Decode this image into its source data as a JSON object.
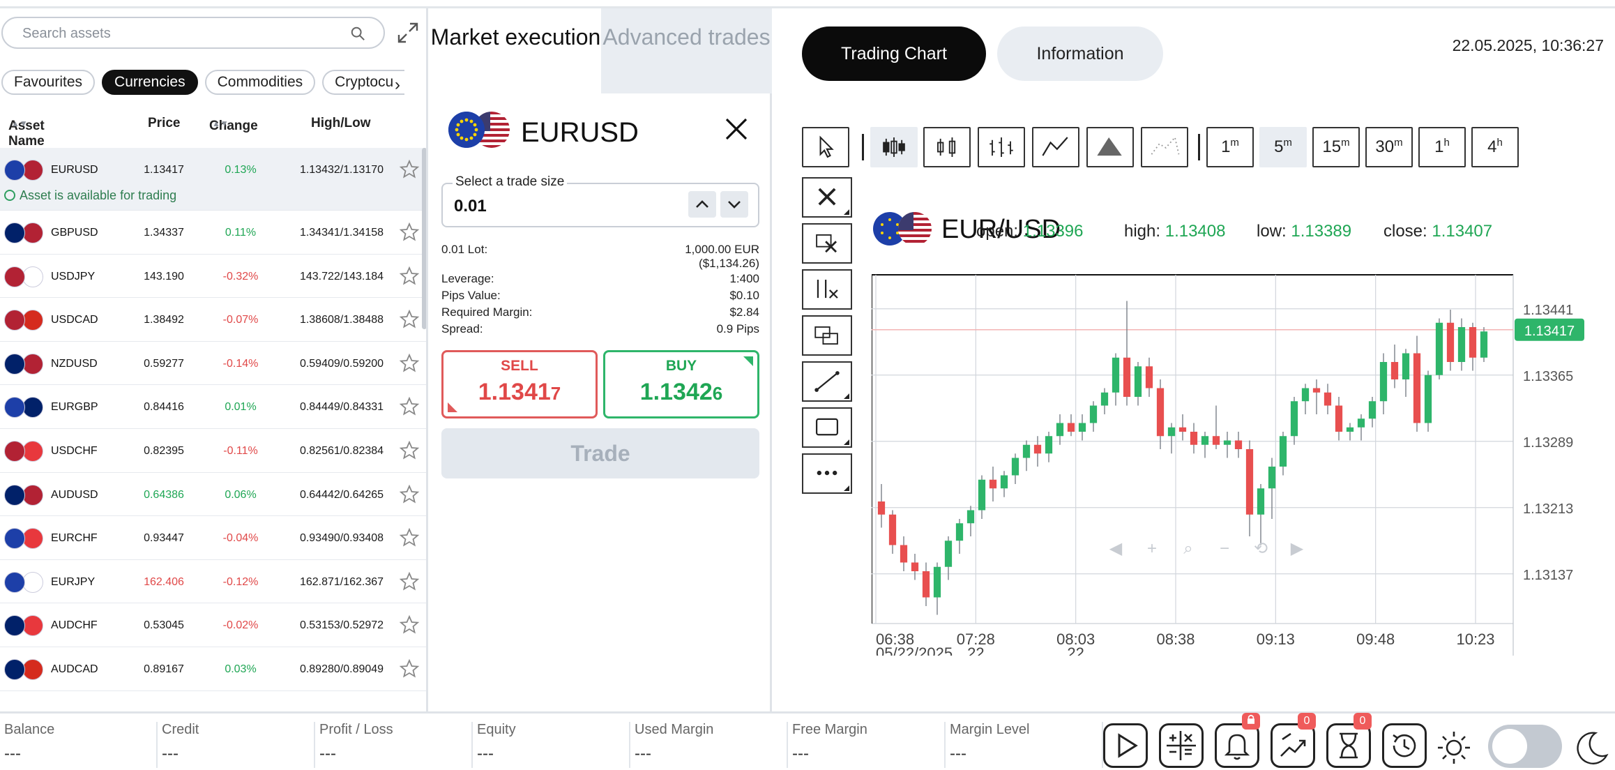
{
  "search": {
    "placeholder": "Search assets"
  },
  "filters": [
    "Favourites",
    "Currencies",
    "Commodities",
    "Cryptocu"
  ],
  "table": {
    "headers": {
      "name": "Asset Name",
      "price": "Price",
      "change": "Change",
      "highlow": "High/Low"
    },
    "available_text": "Asset is available for trading",
    "rows": [
      {
        "symbol": "EURUSD",
        "price": "1.13417",
        "change": "0.13%",
        "hl": "1.13432/1.13170",
        "dir": "pos",
        "pdir": "",
        "f1": "#1d3fa8",
        "f2": "#b22234"
      },
      {
        "symbol": "GBPUSD",
        "price": "1.34337",
        "change": "0.11%",
        "hl": "1.34341/1.34158",
        "dir": "pos",
        "pdir": "",
        "f1": "#012169",
        "f2": "#b22234"
      },
      {
        "symbol": "USDJPY",
        "price": "143.190",
        "change": "-0.32%",
        "hl": "143.722/143.184",
        "dir": "neg",
        "pdir": "",
        "f1": "#b22234",
        "f2": "#ffffff"
      },
      {
        "symbol": "USDCAD",
        "price": "1.38492",
        "change": "-0.07%",
        "hl": "1.38608/1.38488",
        "dir": "neg",
        "pdir": "",
        "f1": "#b22234",
        "f2": "#d52b1e"
      },
      {
        "symbol": "NZDUSD",
        "price": "0.59277",
        "change": "-0.14%",
        "hl": "0.59409/0.59200",
        "dir": "neg",
        "pdir": "",
        "f1": "#012169",
        "f2": "#b22234"
      },
      {
        "symbol": "EURGBP",
        "price": "0.84416",
        "change": "0.01%",
        "hl": "0.84449/0.84331",
        "dir": "pos",
        "pdir": "",
        "f1": "#1d3fa8",
        "f2": "#012169"
      },
      {
        "symbol": "USDCHF",
        "price": "0.82395",
        "change": "-0.11%",
        "hl": "0.82561/0.82384",
        "dir": "neg",
        "pdir": "",
        "f1": "#b22234",
        "f2": "#e8383d"
      },
      {
        "symbol": "AUDUSD",
        "price": "0.64386",
        "change": "0.06%",
        "hl": "0.64442/0.64265",
        "dir": "pos",
        "pdir": "pos",
        "f1": "#012169",
        "f2": "#b22234"
      },
      {
        "symbol": "EURCHF",
        "price": "0.93447",
        "change": "-0.04%",
        "hl": "0.93490/0.93408",
        "dir": "neg",
        "pdir": "",
        "f1": "#1d3fa8",
        "f2": "#e8383d"
      },
      {
        "symbol": "EURJPY",
        "price": "162.406",
        "change": "-0.12%",
        "hl": "162.871/162.367",
        "dir": "neg",
        "pdir": "neg",
        "f1": "#1d3fa8",
        "f2": "#ffffff"
      },
      {
        "symbol": "AUDCHF",
        "price": "0.53045",
        "change": "-0.02%",
        "hl": "0.53153/0.52972",
        "dir": "neg",
        "pdir": "",
        "f1": "#012169",
        "f2": "#e8383d"
      },
      {
        "symbol": "AUDCAD",
        "price": "0.89167",
        "change": "0.03%",
        "hl": "0.89280/0.89049",
        "dir": "pos",
        "pdir": "",
        "f1": "#012169",
        "f2": "#d52b1e"
      }
    ]
  },
  "order": {
    "tab_market": "Market execution",
    "tab_advanced": "Advanced trades",
    "pair": "EURUSD",
    "trade_size_label": "Select a trade size",
    "trade_size_value": "0.01",
    "lot_label": "0.01 Lot:",
    "lot_value": "1,000.00 EUR",
    "lot_value_usd": "($1,134.26)",
    "leverage_label": "Leverage:",
    "leverage_value": "1:400",
    "pips_label": "Pips Value:",
    "pips_value": "$0.10",
    "margin_label": "Required Margin:",
    "margin_value": "$2.84",
    "spread_label": "Spread:",
    "spread_value": "0.9 Pips",
    "sell_label": "SELL",
    "sell_price_main": "1.1341",
    "sell_price_last": "7",
    "buy_label": "BUY",
    "buy_price_main": "1.1342",
    "buy_price_last": "6",
    "trade_label": "Trade"
  },
  "right": {
    "tab_chart": "Trading Chart",
    "tab_info": "Information",
    "datetime": "22.05.2025, 10:36:27",
    "timeframes": [
      {
        "n": "1",
        "u": "m"
      },
      {
        "n": "5",
        "u": "m"
      },
      {
        "n": "15",
        "u": "m"
      },
      {
        "n": "30",
        "u": "m"
      },
      {
        "n": "1",
        "u": "h"
      },
      {
        "n": "4",
        "u": "h"
      }
    ],
    "pair": "EUR/USD",
    "open_label": "open:",
    "open_value": "1.13396",
    "high_label": "high:",
    "high_value": "1.13408",
    "low_label": "low:",
    "low_value": "1.13389",
    "close_label": "close:",
    "close_value": "1.13407"
  },
  "chart_data": {
    "type": "candlestick",
    "title": "",
    "y_ticks": [
      "1.13441",
      "1.13365",
      "1.13289",
      "1.13213",
      "1.13137"
    ],
    "ylim": [
      1.1308,
      1.1348
    ],
    "current_price": "1.13417",
    "x_ticks": [
      {
        "t": "06:38",
        "d": "05/22/2025"
      },
      {
        "t": "07:28",
        "d": "22"
      },
      {
        "t": "08:03",
        "d": "22"
      },
      {
        "t": "08:38",
        "d": ""
      },
      {
        "t": "09:13",
        "d": ""
      },
      {
        "t": "09:48",
        "d": ""
      },
      {
        "t": "10:23",
        "d": ""
      }
    ],
    "candles": [
      [
        1.1322,
        1.1324,
        1.1319,
        1.13205
      ],
      [
        1.13205,
        1.1321,
        1.1316,
        1.1317
      ],
      [
        1.1317,
        1.1318,
        1.1314,
        1.1315
      ],
      [
        1.1315,
        1.1316,
        1.1313,
        1.1314
      ],
      [
        1.1314,
        1.1315,
        1.131,
        1.1311
      ],
      [
        1.1311,
        1.1315,
        1.1309,
        1.13145
      ],
      [
        1.13145,
        1.1318,
        1.1313,
        1.13175
      ],
      [
        1.13175,
        1.132,
        1.1316,
        1.13195
      ],
      [
        1.13195,
        1.13215,
        1.1318,
        1.1321
      ],
      [
        1.1321,
        1.1325,
        1.132,
        1.13245
      ],
      [
        1.13245,
        1.1326,
        1.1322,
        1.13235
      ],
      [
        1.13235,
        1.13255,
        1.13225,
        1.1325
      ],
      [
        1.1325,
        1.13275,
        1.1324,
        1.1327
      ],
      [
        1.1327,
        1.1329,
        1.13255,
        1.13285
      ],
      [
        1.13285,
        1.13295,
        1.1326,
        1.13275
      ],
      [
        1.13275,
        1.133,
        1.13265,
        1.13295
      ],
      [
        1.13295,
        1.1332,
        1.13285,
        1.1331
      ],
      [
        1.1331,
        1.1332,
        1.13295,
        1.133
      ],
      [
        1.133,
        1.1332,
        1.1329,
        1.1331
      ],
      [
        1.1331,
        1.13335,
        1.133,
        1.1333
      ],
      [
        1.1333,
        1.1335,
        1.1332,
        1.13345
      ],
      [
        1.13345,
        1.1339,
        1.1333,
        1.13385
      ],
      [
        1.13385,
        1.1345,
        1.1333,
        1.1334
      ],
      [
        1.1334,
        1.1338,
        1.1333,
        1.13375
      ],
      [
        1.13375,
        1.13385,
        1.1334,
        1.1335
      ],
      [
        1.1335,
        1.1336,
        1.1328,
        1.13295
      ],
      [
        1.13295,
        1.1331,
        1.13275,
        1.13305
      ],
      [
        1.13305,
        1.1332,
        1.1329,
        1.133
      ],
      [
        1.133,
        1.1331,
        1.13275,
        1.13285
      ],
      [
        1.13285,
        1.133,
        1.1327,
        1.13295
      ],
      [
        1.13295,
        1.1333,
        1.1328,
        1.13285
      ],
      [
        1.13285,
        1.133,
        1.1327,
        1.1329
      ],
      [
        1.1329,
        1.133,
        1.1327,
        1.1328
      ],
      [
        1.1328,
        1.1329,
        1.1318,
        1.13205
      ],
      [
        1.13205,
        1.1324,
        1.1317,
        1.13235
      ],
      [
        1.13235,
        1.1327,
        1.132,
        1.1326
      ],
      [
        1.1326,
        1.133,
        1.1325,
        1.13295
      ],
      [
        1.13295,
        1.1334,
        1.13285,
        1.13335
      ],
      [
        1.13335,
        1.13355,
        1.1332,
        1.1335
      ],
      [
        1.1335,
        1.1336,
        1.1332,
        1.13345
      ],
      [
        1.13345,
        1.13355,
        1.1332,
        1.1333
      ],
      [
        1.1333,
        1.1334,
        1.1329,
        1.133
      ],
      [
        1.133,
        1.1331,
        1.1329,
        1.13305
      ],
      [
        1.13305,
        1.1332,
        1.1329,
        1.13315
      ],
      [
        1.13315,
        1.1334,
        1.13305,
        1.13335
      ],
      [
        1.13335,
        1.1339,
        1.1332,
        1.1338
      ],
      [
        1.1338,
        1.134,
        1.1335,
        1.1336
      ],
      [
        1.1336,
        1.13395,
        1.1334,
        1.1339
      ],
      [
        1.1339,
        1.1341,
        1.133,
        1.1331
      ],
      [
        1.1331,
        1.1337,
        1.133,
        1.13365
      ],
      [
        1.13365,
        1.1343,
        1.1336,
        1.13425
      ],
      [
        1.13425,
        1.1344,
        1.1337,
        1.1338
      ],
      [
        1.1338,
        1.1343,
        1.1337,
        1.1342
      ],
      [
        1.1342,
        1.13425,
        1.1337,
        1.13385
      ],
      [
        1.13385,
        1.1342,
        1.1338,
        1.13415
      ]
    ]
  },
  "bottom": {
    "metrics": [
      {
        "label": "Balance",
        "value": "---"
      },
      {
        "label": "Credit",
        "value": "---"
      },
      {
        "label": "Profit / Loss",
        "value": "---"
      },
      {
        "label": "Equity",
        "value": "---"
      },
      {
        "label": "Used Margin",
        "value": "---"
      },
      {
        "label": "Free Margin",
        "value": "---"
      },
      {
        "label": "Margin Level",
        "value": "---"
      }
    ],
    "alerts_badge": "",
    "positions_badge": "0",
    "pending_badge": "0"
  },
  "colors": {
    "up": "#2eb56a",
    "down": "#e84f4f",
    "accent": "#0b0b0b"
  }
}
